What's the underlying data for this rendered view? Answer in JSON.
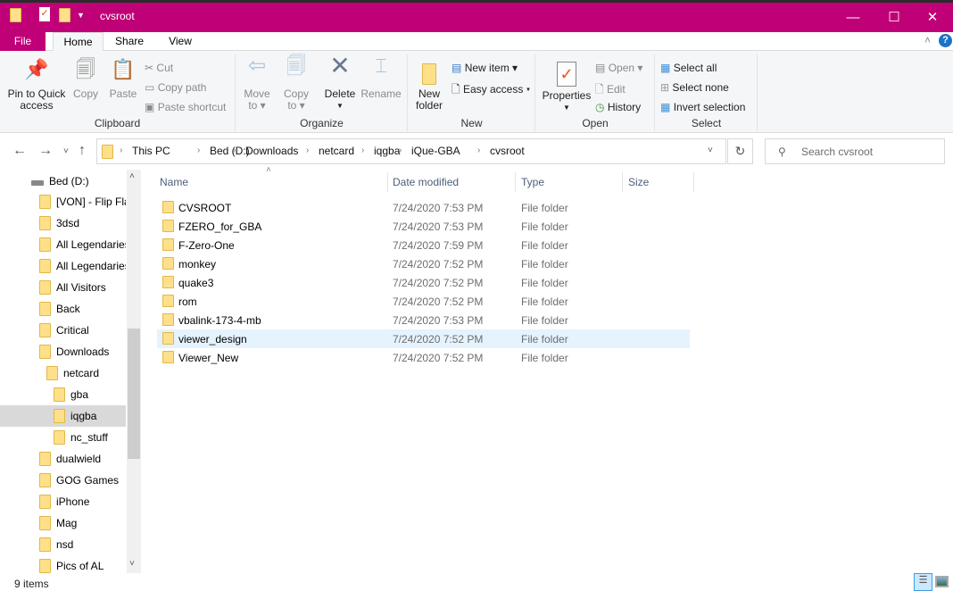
{
  "window": {
    "title": "cvsroot",
    "accent": "#bf0077",
    "controls": [
      "minimize",
      "maximize",
      "close"
    ]
  },
  "tabs": [
    {
      "label": "File"
    },
    {
      "label": "Home"
    },
    {
      "label": "Share"
    },
    {
      "label": "View"
    }
  ],
  "ribbon": {
    "clipboard": {
      "label": "Clipboard",
      "pin": "Pin to Quick access",
      "pin1": "Pin to Quick",
      "pin2": "access",
      "copy": "Copy",
      "paste": "Paste",
      "cut": "Cut",
      "copy_path": "Copy path",
      "paste_shortcut": "Paste shortcut"
    },
    "organize": {
      "label": "Organize",
      "move1": "Move",
      "move2": "to",
      "copy1": "Copy",
      "copy2": "to",
      "delete": "Delete",
      "rename": "Rename"
    },
    "new": {
      "label": "New",
      "new_folder1": "New",
      "new_folder2": "folder",
      "new_item": "New item",
      "easy_access": "Easy access"
    },
    "open": {
      "label": "Open",
      "properties": "Properties",
      "open": "Open",
      "edit": "Edit",
      "history": "History"
    },
    "select": {
      "label": "Select",
      "select_all": "Select all",
      "select_none": "Select none",
      "invert": "Invert selection"
    }
  },
  "address": {
    "crumbs": [
      "This PC",
      "Bed (D:)",
      "Downloads",
      "netcard",
      "iqgba",
      "iQue-GBA",
      "cvsroot"
    ]
  },
  "search": {
    "placeholder": "Search cvsroot"
  },
  "sidebar": {
    "drive": "Bed (D:)",
    "items": [
      {
        "label": "[VON] - Flip Flap",
        "level": 0
      },
      {
        "label": "3dsd",
        "level": 0
      },
      {
        "label": "All Legendaries",
        "level": 0
      },
      {
        "label": "All Legendaries",
        "level": 0
      },
      {
        "label": "All Visitors",
        "level": 0
      },
      {
        "label": "Back",
        "level": 0
      },
      {
        "label": "Critical",
        "level": 0
      },
      {
        "label": "Downloads",
        "level": 0
      },
      {
        "label": "netcard",
        "level": 1
      },
      {
        "label": "gba",
        "level": 2
      },
      {
        "label": "iqgba",
        "level": 2,
        "selected": true
      },
      {
        "label": "nc_stuff",
        "level": 2
      },
      {
        "label": "dualwield",
        "level": 0
      },
      {
        "label": "GOG Games",
        "level": 0
      },
      {
        "label": "iPhone",
        "level": 0
      },
      {
        "label": "Mag",
        "level": 0
      },
      {
        "label": "nsd",
        "level": 0
      },
      {
        "label": "Pics of AL",
        "level": 0
      }
    ]
  },
  "columns": [
    "Name",
    "Date modified",
    "Type",
    "Size"
  ],
  "files": [
    {
      "name": "CVSROOT",
      "date": "7/24/2020 7:53 PM",
      "type": "File folder"
    },
    {
      "name": "FZERO_for_GBA",
      "date": "7/24/2020 7:53 PM",
      "type": "File folder"
    },
    {
      "name": "F-Zero-One",
      "date": "7/24/2020 7:59 PM",
      "type": "File folder"
    },
    {
      "name": "monkey",
      "date": "7/24/2020 7:52 PM",
      "type": "File folder"
    },
    {
      "name": "quake3",
      "date": "7/24/2020 7:52 PM",
      "type": "File folder"
    },
    {
      "name": "rom",
      "date": "7/24/2020 7:52 PM",
      "type": "File folder"
    },
    {
      "name": "vbalink-173-4-mb",
      "date": "7/24/2020 7:53 PM",
      "type": "File folder"
    },
    {
      "name": "viewer_design",
      "date": "7/24/2020 7:52 PM",
      "type": "File folder",
      "hovered": true
    },
    {
      "name": "Viewer_New",
      "date": "7/24/2020 7:52 PM",
      "type": "File folder"
    }
  ],
  "status": {
    "items": "9 items"
  }
}
